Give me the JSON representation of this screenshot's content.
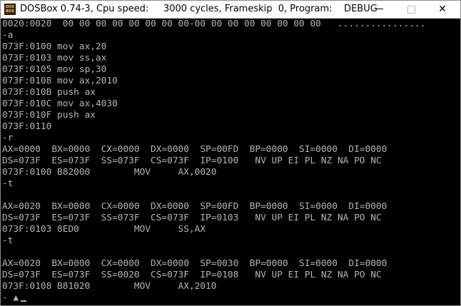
{
  "window": {
    "title": "DOSBox 0.74-3, Cpu speed:     3000 cycles, Frameskip  0, Program:    DEBUG",
    "icon_line1": "DOS",
    "icon_line2": "BOX",
    "icon": "dosbox-icon",
    "controls": {
      "minimize": "minimize-icon",
      "maximize": "maximize-icon",
      "close": "✕"
    }
  },
  "console": {
    "text_color": "#b4b4b4",
    "background": "#000000",
    "lines": [
      "0020:0020  00 00 00 00 00 00 00 00-00 00 00 00 00 00 00 00   ................",
      "-a",
      "073F:0100 mov ax,20",
      "073F:0103 mov ss,ax",
      "073F:0105 mov sp,30",
      "073F:0108 mov ax,2010",
      "073F:010B push ax",
      "073F:010C mov ax,4030",
      "073F:010F push ax",
      "073F:0110",
      "-r",
      "AX=0000  BX=0000  CX=0000  DX=0000  SP=00FD  BP=0000  SI=0000  DI=0000",
      "DS=073F  ES=073F  SS=073F  CS=073F  IP=0100   NV UP EI PL NZ NA PO NC",
      "073F:0100 B82000        MOV     AX,0020",
      "-t",
      "",
      "AX=0020  BX=0000  CX=0000  DX=0000  SP=00FD  BP=0000  SI=0000  DI=0000",
      "DS=073F  ES=073F  SS=073F  CS=073F  IP=0103   NV UP EI PL NZ NA PO NC",
      "073F:0103 8ED0          MOV     SS,AX",
      "-t",
      "",
      "AX=0020  BX=0000  CX=0000  DX=0000  SP=0030  BP=0000  SI=0000  DI=0000",
      "DS=073F  ES=073F  SS=0020  CS=073F  IP=0108   NV UP EI PL NZ NA PO NC",
      "073F:0108 B81020        MOV     AX,2010",
      "- ▲"
    ]
  }
}
